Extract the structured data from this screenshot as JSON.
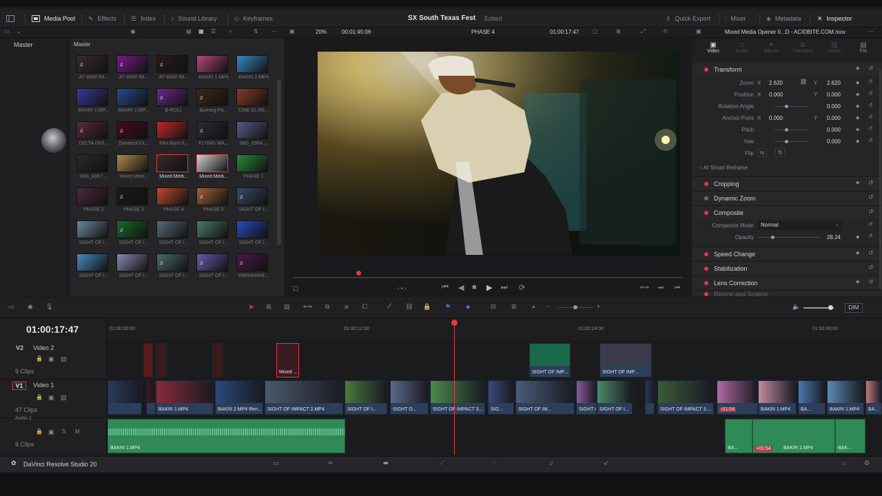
{
  "menubar": {
    "media_pool": "Media Pool",
    "effects": "Effects",
    "index": "Index",
    "sound_library": "Sound Library",
    "keyframes": "Keyframes",
    "project_title": "SX South Texas Fest",
    "project_status": "Edited",
    "quick_export": "Quick Export",
    "mixer": "Mixer",
    "metadata": "Metadata",
    "inspector": "Inspector"
  },
  "subbar": {
    "zoom": "20%",
    "duration": "00:01:45:06",
    "timeline_name": "PHASE 4",
    "timecode": "01:00:17:47",
    "clip_name": "Mixed Media Opener 0...D - ACIDBITE.COM.mov"
  },
  "left_panel": {
    "title": "Master"
  },
  "pool": {
    "title": "Master",
    "clips": [
      {
        "label": "AT WAR WI...",
        "color": "#3a2c2a",
        "type": "audio"
      },
      {
        "label": "AT WAR WI...",
        "color": "#7a1a8a",
        "type": "audio"
      },
      {
        "label": "AT WAR WI...",
        "color": "#2a1a1a",
        "type": "audio"
      },
      {
        "label": "BAKRI 1.MP4",
        "color": "#b04a7a",
        "type": "video"
      },
      {
        "label": "BAKRI 2.MP4",
        "color": "#3a8ac0",
        "type": "video"
      },
      {
        "label": "BAKRI 2.MP...",
        "color": "#3a3aa0",
        "type": "video"
      },
      {
        "label": "BAKRI 2.MP...",
        "color": "#2a4a8a",
        "type": "video"
      },
      {
        "label": "B-ROLL",
        "color": "#6a2a8a",
        "type": "audio"
      },
      {
        "label": "Burning Pa...",
        "color": "#3a2a1a",
        "type": "audio"
      },
      {
        "label": "CINE EL RE...",
        "color": "#8a3a2a",
        "type": "video"
      },
      {
        "label": "DELTA DIVI...",
        "color": "#5a2a3a",
        "type": "audio"
      },
      {
        "label": "DynamiXXX...",
        "color": "#4a0a1a",
        "type": "audio"
      },
      {
        "label": "Film Burn 9...",
        "color": "#c02a2a",
        "type": "video"
      },
      {
        "label": "FLYING WA...",
        "color": "#2a2a3a",
        "type": "audio"
      },
      {
        "label": "IMG_8364....",
        "color": "#5a5a8a",
        "type": "video"
      },
      {
        "label": "IMG_8367....",
        "color": "#2a2a2a",
        "type": "video"
      },
      {
        "label": "Mixed Medi...",
        "color": "#b08a4a",
        "type": "video"
      },
      {
        "label": "Mixed Medi...",
        "color": "#3a2a2a",
        "type": "video",
        "selected": true
      },
      {
        "label": "Mixed Medi...",
        "color": "#d0d0d0",
        "type": "video",
        "selected": true
      },
      {
        "label": "PHASE 1",
        "color": "#2a8a3a",
        "type": "video"
      },
      {
        "label": "PHASE 2",
        "color": "#4a2a3a",
        "type": "video"
      },
      {
        "label": "PHASE 3",
        "color": "#1a1a1a",
        "type": "audio"
      },
      {
        "label": "PHASE 4",
        "color": "#c04a2a",
        "type": "video"
      },
      {
        "label": "PHASE 5",
        "color": "#a0603a",
        "type": "audio"
      },
      {
        "label": "SIGHT OF I...",
        "color": "#3a4a6a",
        "type": "audio"
      },
      {
        "label": "SIGHT OF I...",
        "color": "#6a8aa0",
        "type": "video"
      },
      {
        "label": "SIGHT OF I...",
        "color": "#1a6a2a",
        "type": "audio"
      },
      {
        "label": "SIGHT OF I...",
        "color": "#5a6a7a",
        "type": "video"
      },
      {
        "label": "SIGHT OF I...",
        "color": "#4a7a6a",
        "type": "video"
      },
      {
        "label": "SIGHT OF I...",
        "color": "#2a4ac0",
        "type": "video"
      },
      {
        "label": "SIGHT OF I...",
        "color": "#4a8ac0",
        "type": "video"
      },
      {
        "label": "SIGHT OF I...",
        "color": "#8a8ab0",
        "type": "video"
      },
      {
        "label": "SIGHT OF I...",
        "color": "#4a6a6a",
        "type": "audio"
      },
      {
        "label": "SIGHT OF I...",
        "color": "#6a5ab0",
        "type": "audio"
      },
      {
        "label": "VIBRAHAVE...",
        "color": "#4a1a4a",
        "type": "audio"
      }
    ]
  },
  "inspector": {
    "tabs": [
      "Video",
      "Audio",
      "Effects",
      "Transition",
      "Image",
      "File"
    ],
    "transform": "Transform",
    "zoom_label": "Zoom",
    "zoom_x": "2.620",
    "zoom_y": "2.620",
    "position_label": "Position",
    "position_x": "0.000",
    "position_y": "0.000",
    "rotation_label": "Rotation Angle",
    "rotation": "0.000",
    "anchor_label": "Anchor Point",
    "anchor_x": "0.000",
    "anchor_y": "0.000",
    "pitch_label": "Pitch",
    "pitch": "0.000",
    "yaw_label": "Yaw",
    "yaw": "0.000",
    "flip_label": "Flip",
    "ai_reframe": "AI Smart Reframe",
    "cropping": "Cropping",
    "dynamic_zoom": "Dynamic Zoom",
    "composite": "Composite",
    "composite_mode_label": "Composite Mode",
    "composite_mode": "Normal",
    "opacity_label": "Opacity",
    "opacity": "28.24",
    "speed_change": "Speed Change",
    "stabilization": "Stabilization",
    "lens_correction": "Lens Correction",
    "retime_scaling": "Retime and Scaling"
  },
  "timeline": {
    "timecode": "01:00:17:47",
    "ruler": [
      "01:00:00:00",
      "01:00:12:00",
      "01:00:24:00",
      "01:00:36:00"
    ],
    "v2_id": "V2",
    "v2_name": "Video 2",
    "v2_clips": "9 Clips",
    "v1_id": "V1",
    "v1_name": "Video 1",
    "v1_clips": "47 Clips",
    "a1_id": "A1",
    "a1_name": "Audio 1",
    "a1_clips": "6 Clips",
    "v2_items": [
      "Mixed ...",
      "SIGHT OF IMP...",
      "SIGHT OF IMP..."
    ],
    "v1_items": [
      "BAKRI 1.MP4",
      "BAKRI 2.MP4 Ren...",
      "SIGHT OF IMPACT 2.MP4",
      "SIGHT OF I...",
      "SIGHT O...",
      "SIGHT OF IMPACT 3....",
      "SIG...",
      "SIGHT OF IM...",
      "SIGHT OF IMP...",
      "SIGHT OF I...",
      "SIGHT OF IMPACT 3....",
      "-01:54",
      "BAKRI 1.MP4",
      "BA...",
      "BAKRI 1.MP4",
      "BA..."
    ],
    "a1_items": [
      "BAKRI 1.MP4",
      "BA...",
      "+01:54",
      "BAKRI 1.MP4",
      "BAK..."
    ],
    "dim": "DIM"
  },
  "footer": {
    "app_name": "DaVinci Resolve Studio 20"
  }
}
